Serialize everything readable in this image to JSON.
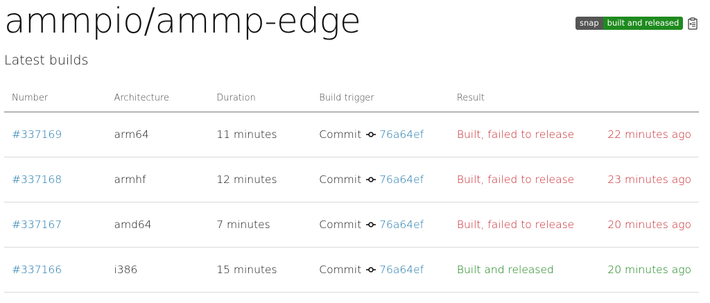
{
  "page": {
    "title": "ammpio/ammp-edge",
    "subtitle": "Latest builds"
  },
  "badge": {
    "left": "snap",
    "right": "built and released",
    "icon": "clipboard-icon"
  },
  "table": {
    "headers": [
      "Number",
      "Architecture",
      "Duration",
      "Build trigger",
      "Result",
      ""
    ],
    "rows": [
      {
        "number": "#337169",
        "arch": "arm64",
        "duration": "11 minutes",
        "trigger": "Commit",
        "commit": "76a64ef",
        "result": "Built, failed to release",
        "when": "22 minutes ago",
        "status": "failed"
      },
      {
        "number": "#337168",
        "arch": "armhf",
        "duration": "12 minutes",
        "trigger": "Commit",
        "commit": "76a64ef",
        "result": "Built, failed to release",
        "when": "23 minutes ago",
        "status": "failed"
      },
      {
        "number": "#337167",
        "arch": "amd64",
        "duration": "7 minutes",
        "trigger": "Commit",
        "commit": "76a64ef",
        "result": "Built, failed to release",
        "when": "20 minutes ago",
        "status": "failed"
      },
      {
        "number": "#337166",
        "arch": "i386",
        "duration": "15 minutes",
        "trigger": "Commit",
        "commit": "76a64ef",
        "result": "Built and released",
        "when": "20 minutes ago",
        "status": "released"
      }
    ]
  },
  "colors": {
    "link": "#1774a8",
    "failed": "#c7252c",
    "released": "#0e7d0e",
    "badge_left": "#555555",
    "badge_right": "#1e8a1e"
  }
}
